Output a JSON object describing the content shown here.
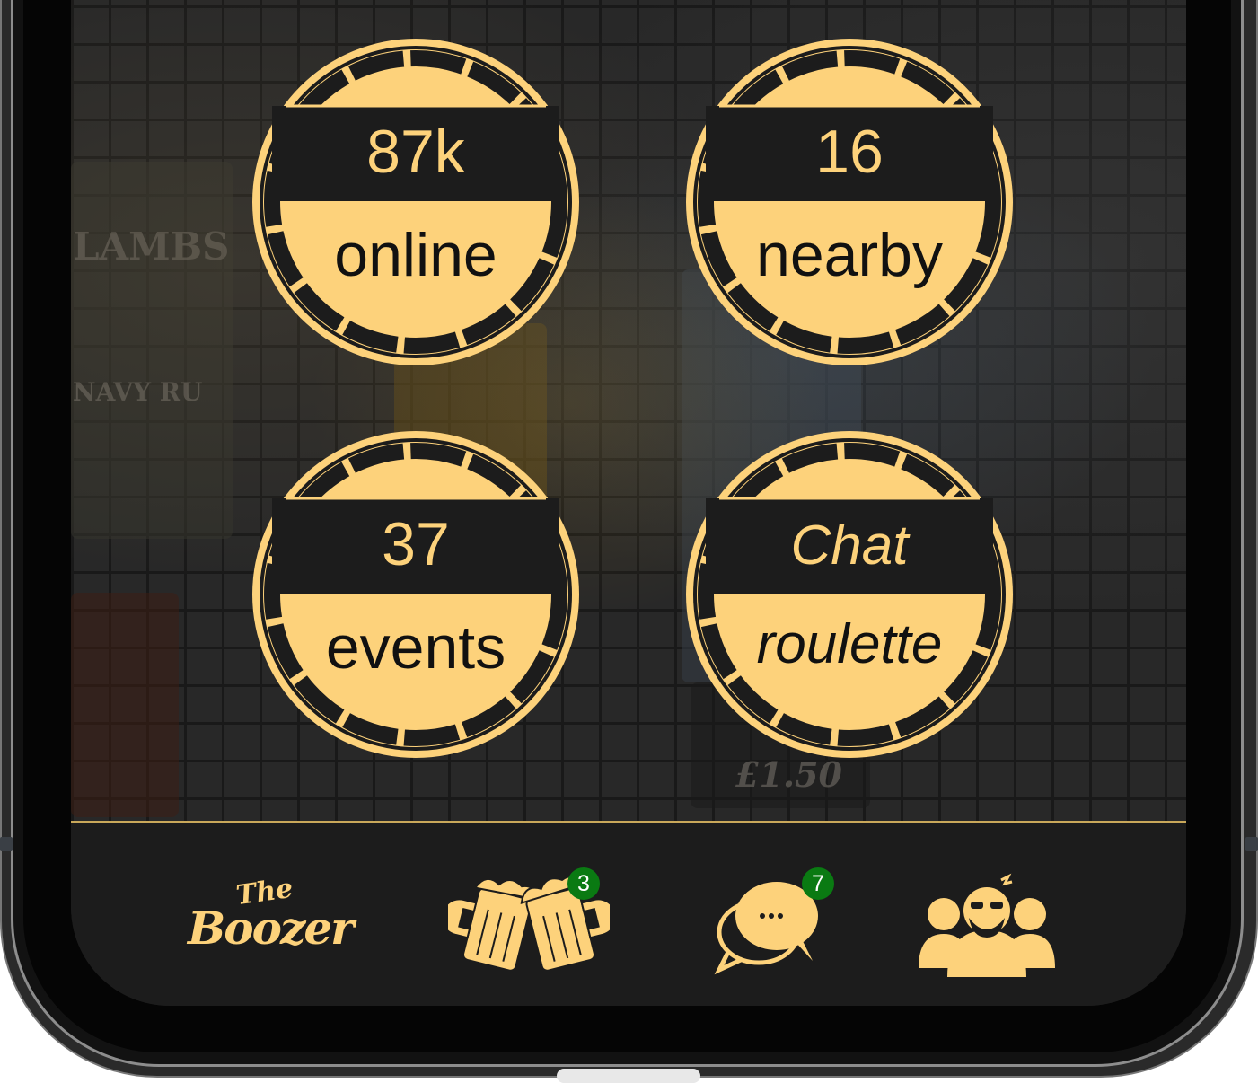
{
  "stats": [
    {
      "value": "87k",
      "label": "online"
    },
    {
      "value": "16",
      "label": "nearby"
    },
    {
      "value": "37",
      "label": "events"
    },
    {
      "value": "Chat",
      "label": "roulette"
    }
  ],
  "tabs": [
    {
      "name": "The Booze",
      "badge": null
    },
    {
      "name": "beer-mugs",
      "badge": "3"
    },
    {
      "name": "chat",
      "badge": "7"
    },
    {
      "name": "friends",
      "badge": null
    }
  ],
  "logo": {
    "line1": "The",
    "line2": "Boozer"
  },
  "colors": {
    "gold": "#fdd27b",
    "dark": "#1c1c1c",
    "badge_green": "#0a7a12"
  }
}
